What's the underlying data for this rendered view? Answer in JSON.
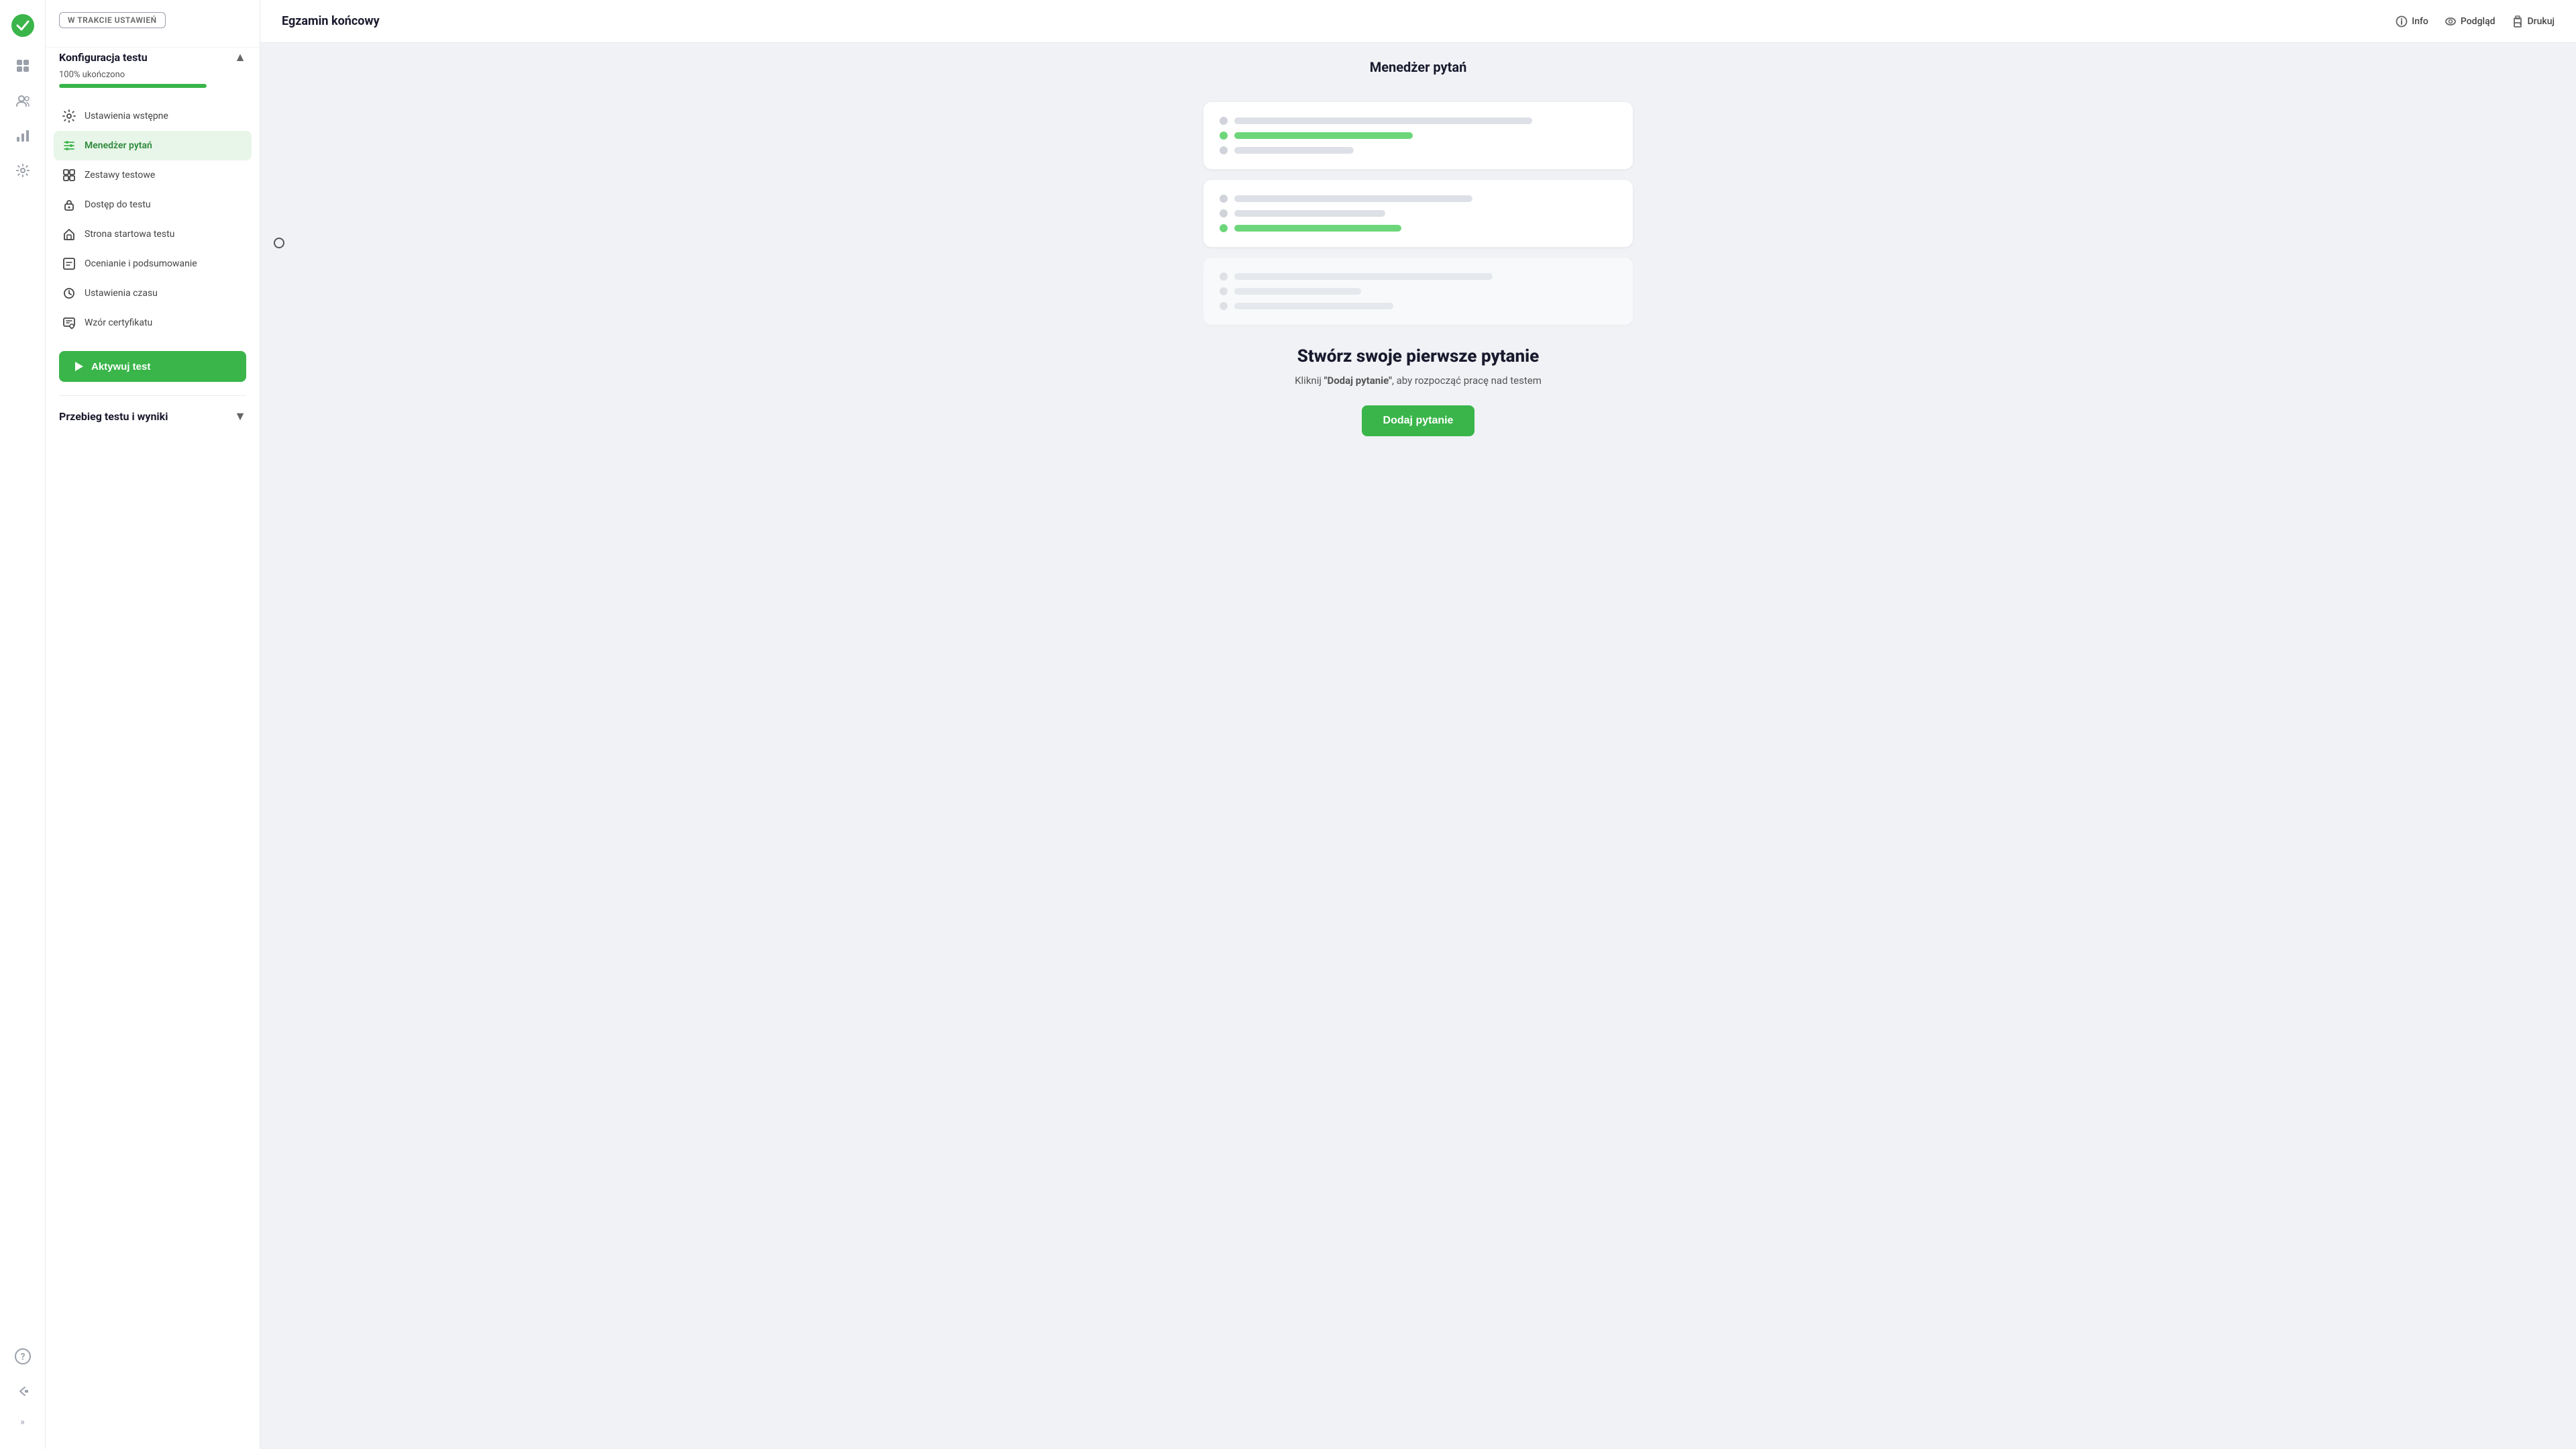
{
  "app": {
    "logo_label": "Logo",
    "title": "Egzamin końcowy"
  },
  "topbar": {
    "title": "Egzamin końcowy",
    "actions": {
      "info": "Info",
      "preview": "Podgląd",
      "print": "Drukuj"
    }
  },
  "sidebar": {
    "status_badge": "W TRAKCIE USTAWIEŃ",
    "section1": {
      "title": "Konfiguracja testu",
      "toggle": "▲"
    },
    "progress": {
      "label": "100% ukończono"
    },
    "nav_items": [
      {
        "id": "initial-settings",
        "label": "Ustawienia wstępne",
        "icon": "settings-icon"
      },
      {
        "id": "question-manager",
        "label": "Menedżer pytań",
        "icon": "sliders-icon",
        "active": true
      },
      {
        "id": "test-sets",
        "label": "Zestawy testowe",
        "icon": "grid-icon"
      },
      {
        "id": "test-access",
        "label": "Dostęp do testu",
        "icon": "lock-icon"
      },
      {
        "id": "test-start-page",
        "label": "Strona startowa testu",
        "icon": "home-icon"
      },
      {
        "id": "grading-summary",
        "label": "Ocenianie i podsumowanie",
        "icon": "chart-icon"
      },
      {
        "id": "time-settings",
        "label": "Ustawienia czasu",
        "icon": "clock-icon"
      },
      {
        "id": "certificate-template",
        "label": "Wzór certyfikatu",
        "icon": "certificate-icon"
      }
    ],
    "activate_btn": "Aktywuj test",
    "section2": {
      "title": "Przebieg testu i wyniki",
      "toggle": "▼"
    }
  },
  "main": {
    "page_title": "Menedżer pytań",
    "empty_state": {
      "title": "Stwórz swoje pierwsze pytanie",
      "description_pre": "Kliknij ",
      "description_bold": "\"Dodaj pytanie\"",
      "description_post": ", aby rozpocząć pracę nad testem",
      "add_button": "Dodaj pytanie"
    }
  },
  "icon_bar": {
    "logo": "✓",
    "grid": "▦",
    "users": "👤",
    "bar_chart": "📊",
    "settings": "⚙",
    "question": "?",
    "back_arrow": "↩",
    "chevron_double": "»"
  }
}
